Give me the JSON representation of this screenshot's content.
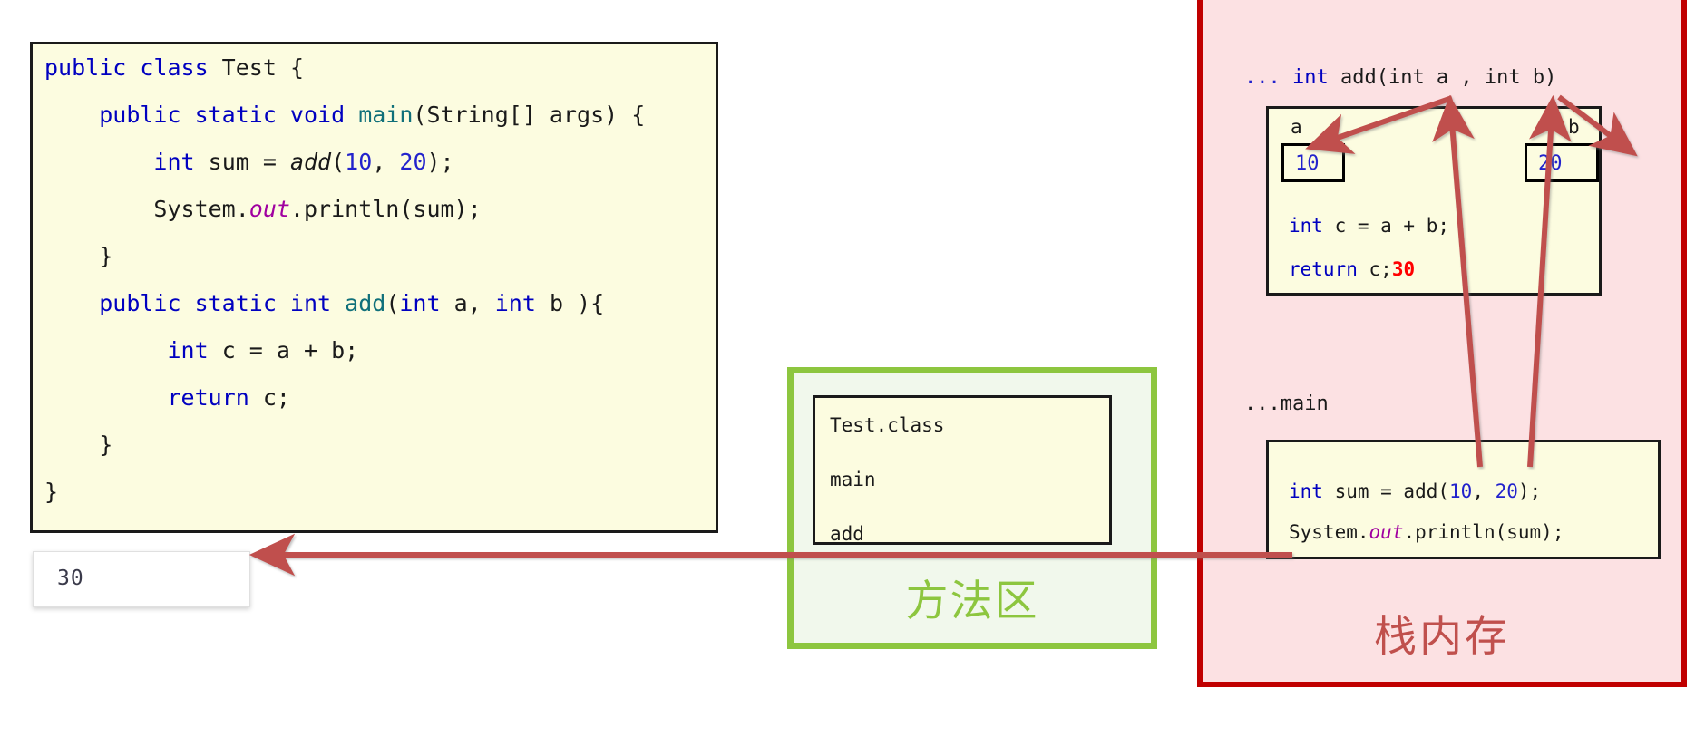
{
  "source_code": {
    "lines": [
      [
        {
          "t": "public class ",
          "c": "kw"
        },
        {
          "t": "Test",
          "c": "plain"
        },
        {
          "t": " {",
          "c": "plain"
        }
      ],
      [
        {
          "t": "    ",
          "c": "plain"
        },
        {
          "t": "public static void ",
          "c": "kw"
        },
        {
          "t": "main",
          "c": "mth"
        },
        {
          "t": "(String[] args) {",
          "c": "plain"
        }
      ],
      [
        {
          "t": "        ",
          "c": "plain"
        },
        {
          "t": "int ",
          "c": "kw"
        },
        {
          "t": "sum = ",
          "c": "plain"
        },
        {
          "t": "add",
          "c": "ital"
        },
        {
          "t": "(",
          "c": "plain"
        },
        {
          "t": "10",
          "c": "num"
        },
        {
          "t": ", ",
          "c": "plain"
        },
        {
          "t": "20",
          "c": "num"
        },
        {
          "t": ");",
          "c": "plain"
        }
      ],
      [
        {
          "t": "        System.",
          "c": "plain"
        },
        {
          "t": "out",
          "c": "out"
        },
        {
          "t": ".println(sum);",
          "c": "plain"
        }
      ],
      [
        {
          "t": "    }",
          "c": "plain"
        }
      ],
      [
        {
          "t": "    ",
          "c": "plain"
        },
        {
          "t": "public static int ",
          "c": "kw"
        },
        {
          "t": "add",
          "c": "mth"
        },
        {
          "t": "(",
          "c": "plain"
        },
        {
          "t": "int ",
          "c": "kw"
        },
        {
          "t": "a, ",
          "c": "plain"
        },
        {
          "t": "int ",
          "c": "kw"
        },
        {
          "t": "b ){",
          "c": "plain"
        }
      ],
      [
        {
          "t": "         ",
          "c": "plain"
        },
        {
          "t": "int ",
          "c": "kw"
        },
        {
          "t": "c = a + b;",
          "c": "plain"
        }
      ],
      [
        {
          "t": "         ",
          "c": "plain"
        },
        {
          "t": "return ",
          "c": "kw"
        },
        {
          "t": "c;",
          "c": "plain"
        }
      ],
      [
        {
          "t": "    }",
          "c": "plain"
        }
      ],
      [
        {
          "t": "}",
          "c": "plain"
        }
      ]
    ]
  },
  "console": {
    "output": "30"
  },
  "method_area": {
    "label": "方法区",
    "entries": [
      "Test.class",
      "main",
      "add"
    ],
    "border_color": "#8dc63f"
  },
  "stack_memory": {
    "label": "栈内存",
    "border_color": "#c00000",
    "fill_color": "#fce1e3",
    "add_frame": {
      "title": [
        {
          "t": "... ",
          "c": "num"
        },
        {
          "t": "int ",
          "c": "kw"
        },
        {
          "t": "add(int a , int b)",
          "c": "plain"
        }
      ],
      "var_a": {
        "name": "a",
        "value": "10"
      },
      "var_b": {
        "name": "b",
        "value": "20"
      },
      "lines": [
        [
          {
            "t": "int ",
            "c": "kw"
          },
          {
            "t": "c = a + b;",
            "c": "plain"
          }
        ],
        [
          {
            "t": "return ",
            "c": "kw"
          },
          {
            "t": "c;",
            "c": "plain"
          },
          {
            "t": "30",
            "c": "red"
          }
        ]
      ]
    },
    "main_frame": {
      "title": [
        {
          "t": "...main",
          "c": "plain"
        }
      ],
      "lines": [
        [
          {
            "t": "int ",
            "c": "kw"
          },
          {
            "t": "sum = add(",
            "c": "plain"
          },
          {
            "t": "10",
            "c": "num"
          },
          {
            "t": ", ",
            "c": "plain"
          },
          {
            "t": "20",
            "c": "num"
          },
          {
            "t": ");",
            "c": "plain"
          }
        ],
        [
          {
            "t": "System.",
            "c": "plain"
          },
          {
            "t": "out",
            "c": "out"
          },
          {
            "t": ".println(sum);",
            "c": "plain"
          }
        ]
      ]
    }
  },
  "arrows": {
    "color": "#c0504d",
    "items": [
      {
        "name": "arrow-println-to-console",
        "desc": "from main frame println line leftwards to console output box"
      },
      {
        "name": "arrow-arg10-to-param-a",
        "desc": "from main call argument 10 up to parameter a in add signature"
      },
      {
        "name": "arrow-arg20-to-param-b",
        "desc": "from main call argument 20 up to parameter b in add signature"
      },
      {
        "name": "arrow-param-a-to-slot-a",
        "desc": "from parameter a down-left into variable slot a"
      },
      {
        "name": "arrow-param-b-to-slot-b",
        "desc": "from parameter b down-right into variable slot b"
      }
    ]
  }
}
